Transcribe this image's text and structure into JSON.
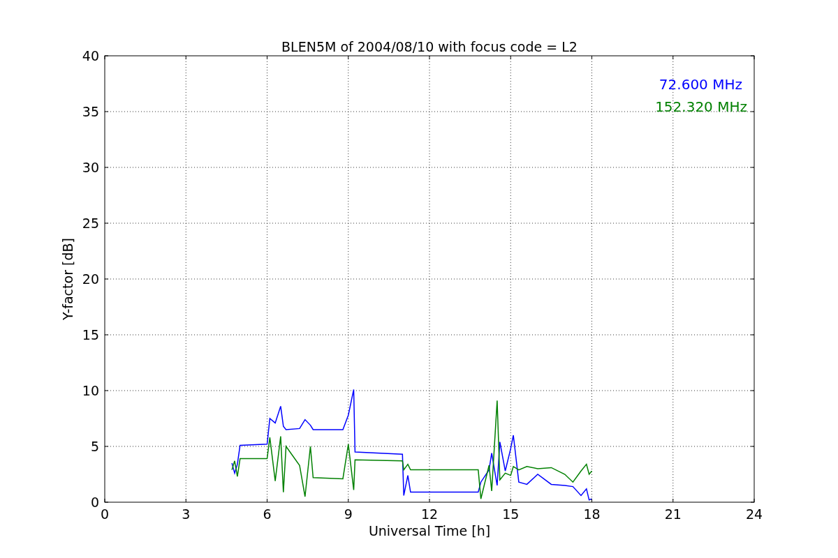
{
  "chart_data": {
    "type": "line",
    "title": "BLEN5M of 2004/08/10 with focus code = L2",
    "xlabel": "Universal Time [h]",
    "ylabel": "Y-factor [dB]",
    "x": [
      4.7,
      4.8,
      4.9,
      5.0,
      6.0,
      6.1,
      6.3,
      6.5,
      6.6,
      6.7,
      7.2,
      7.4,
      7.6,
      7.7,
      8.8,
      9.0,
      9.2,
      9.25,
      11.0,
      11.05,
      11.2,
      11.3,
      13.8,
      13.9,
      14.2,
      14.3,
      14.5,
      14.6,
      14.8,
      15.0,
      15.1,
      15.3,
      15.6,
      16.0,
      16.5,
      17.0,
      17.3,
      17.6,
      17.8,
      17.9,
      18.0
    ],
    "series": [
      {
        "name": "72.600 MHz",
        "color": "#0000ff",
        "values": [
          3.5,
          2.6,
          3.4,
          5.1,
          5.2,
          7.5,
          7.1,
          8.6,
          6.8,
          6.5,
          6.6,
          7.4,
          6.9,
          6.5,
          6.5,
          7.8,
          10.1,
          4.5,
          4.3,
          0.6,
          2.4,
          0.9,
          0.9,
          1.8,
          2.9,
          4.4,
          1.5,
          5.4,
          2.8,
          4.8,
          6.0,
          1.8,
          1.6,
          2.5,
          1.6,
          1.5,
          1.4,
          0.6,
          1.2,
          0.2,
          0.3
        ]
      },
      {
        "name": "152.320 MHz",
        "color": "#008000",
        "values": [
          2.9,
          3.7,
          2.3,
          3.9,
          3.9,
          5.8,
          1.9,
          5.9,
          0.9,
          5.0,
          3.3,
          0.5,
          5.0,
          2.2,
          2.1,
          5.2,
          1.1,
          3.8,
          3.7,
          2.9,
          3.4,
          2.9,
          2.9,
          0.3,
          3.3,
          1.0,
          9.1,
          2.0,
          2.6,
          2.4,
          3.2,
          2.9,
          3.2,
          3.0,
          3.1,
          2.5,
          1.8,
          2.8,
          3.4,
          2.5,
          2.8
        ]
      }
    ],
    "grid": true,
    "xlim": [
      0,
      24
    ],
    "ylim": [
      0,
      40
    ],
    "xticks": [
      0,
      3,
      6,
      9,
      12,
      15,
      18,
      21,
      24
    ],
    "yticks": [
      0,
      5,
      10,
      15,
      20,
      25,
      30,
      35,
      40
    ]
  }
}
